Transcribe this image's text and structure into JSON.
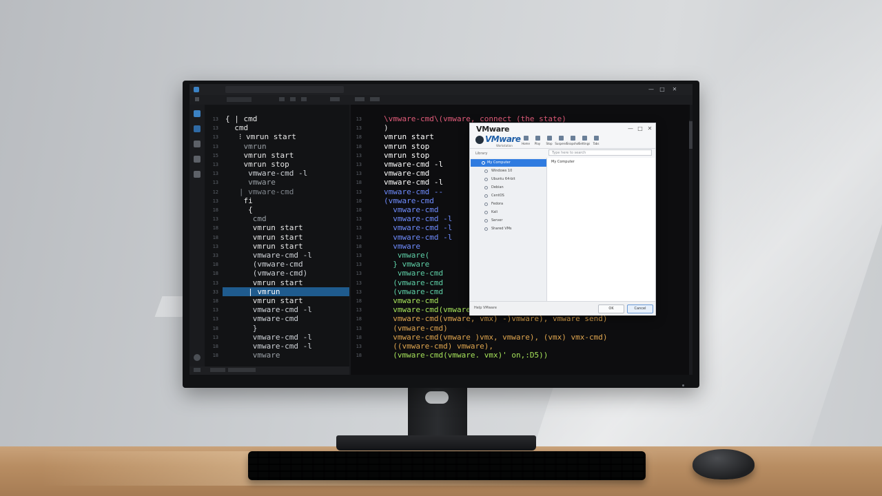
{
  "window": {
    "tabs": [
      "",
      ""
    ],
    "controls": [
      "—",
      "□",
      "✕"
    ]
  },
  "left_lines": [
    {
      "ln": "13",
      "text": "{ | cmd",
      "color": "#e8e8e8"
    },
    {
      "ln": "13",
      "text": "  cmd",
      "color": "#e8e8e8"
    },
    {
      "ln": "13",
      "text": "   ⁝ vmrun start",
      "color": "#e8e8e8"
    },
    {
      "ln": "13",
      "text": "    vmrun",
      "color": "#9aa0a6"
    },
    {
      "ln": "15",
      "text": "    vmrun start",
      "color": "#e8e8e8"
    },
    {
      "ln": "13",
      "text": "    vmrun stop",
      "color": "#e8e8e8"
    },
    {
      "ln": "13",
      "text": "     vmware-cmd -l",
      "color": "#cfd3d8"
    },
    {
      "ln": "13",
      "text": "     vmware",
      "color": "#9aa0a6"
    },
    {
      "ln": "12",
      "text": "   | vmware-cmd",
      "color": "#7f858c"
    },
    {
      "ln": "13",
      "text": "    fi",
      "color": "#e8e8e8"
    },
    {
      "ln": "18",
      "text": "     {",
      "color": "#e8e8e8"
    },
    {
      "ln": "13",
      "text": "      cmd",
      "color": "#9aa0a6"
    },
    {
      "ln": "18",
      "text": "      vmrun start",
      "color": "#e8e8e8"
    },
    {
      "ln": "18",
      "text": "      vmrun start",
      "color": "#e8e8e8"
    },
    {
      "ln": "13",
      "text": "      vmrun start",
      "color": "#e8e8e8"
    },
    {
      "ln": "33",
      "text": "      vmware-cmd -l",
      "color": "#cfd3d8"
    },
    {
      "ln": "18",
      "text": "      (vmware-cmd",
      "color": "#cfd3d8"
    },
    {
      "ln": "18",
      "text": "      (vmware-cmd)",
      "color": "#cfd3d8"
    },
    {
      "ln": "13",
      "text": "      vmrun start",
      "color": "#e8e8e8"
    },
    {
      "ln": "33",
      "text": "     | vmrun",
      "color": "#ffffff"
    },
    {
      "ln": "18",
      "text": "      vmrun start",
      "color": "#e8e8e8"
    },
    {
      "ln": "13",
      "text": "      vmware-cmd -l",
      "color": "#cfd3d8"
    },
    {
      "ln": "13",
      "text": "      vmware-cmd",
      "color": "#cfd3d8"
    },
    {
      "ln": "18",
      "text": "      }",
      "color": "#cfd3d8"
    },
    {
      "ln": "13",
      "text": "      vmware-cmd -l",
      "color": "#cfd3d8"
    },
    {
      "ln": "18",
      "text": "      vmware-cmd -l",
      "color": "#cfd3d8"
    },
    {
      "ln": "18",
      "text": "      vmware",
      "color": "#9aa0a6"
    }
  ],
  "right_lines": [
    {
      "ln": "13",
      "text": "\\vmware-cmd\\(vmware, connect (the state)",
      "color": "#e25c7a"
    },
    {
      "ln": "13",
      "text": ")",
      "color": "#e8e8e8"
    },
    {
      "ln": "18",
      "text": "vmrun start",
      "color": "#ffffff"
    },
    {
      "ln": "18",
      "text": "vmrun stop",
      "color": "#ffffff"
    },
    {
      "ln": "13",
      "text": "vmrun stop",
      "color": "#ffffff"
    },
    {
      "ln": "13",
      "text": "vmware-cmd -l",
      "color": "#ffffff"
    },
    {
      "ln": "13",
      "text": "vmware-cmd",
      "color": "#ffffff"
    },
    {
      "ln": "18",
      "text": "vmware-cmd -l",
      "color": "#ffffff"
    },
    {
      "ln": "13",
      "text": "vmware-cmd --",
      "color": "#6f8cff"
    },
    {
      "ln": "18",
      "text": "(vmware-cmd",
      "color": "#6f8cff"
    },
    {
      "ln": "18",
      "text": "  vmware-cmd",
      "color": "#6f8cff"
    },
    {
      "ln": "13",
      "text": "  vmware-cmd -l",
      "color": "#6f8cff"
    },
    {
      "ln": "13",
      "text": "  vmware-cmd -l",
      "color": "#6f8cff"
    },
    {
      "ln": "13",
      "text": "  vmware-cmd -l",
      "color": "#6f8cff"
    },
    {
      "ln": "18",
      "text": "  vmware",
      "color": "#6f8cff"
    },
    {
      "ln": "13",
      "text": "   vmware(",
      "color": "#5fd1a8"
    },
    {
      "ln": "13",
      "text": "  } vmware",
      "color": "#5fd1a8"
    },
    {
      "ln": "13",
      "text": "   vmware-cmd",
      "color": "#5fd1a8"
    },
    {
      "ln": "13",
      "text": "  (vmware-cmd",
      "color": "#5fd1a8"
    },
    {
      "ln": "13",
      "text": "  (vmware-cmd",
      "color": "#5fd1a8"
    },
    {
      "ln": "18",
      "text": "  vmware-cmd",
      "color": "#a6e35a"
    },
    {
      "ln": "13",
      "text": "  vmware-cmd(vmware) -l",
      "color": "#a6e35a"
    },
    {
      "ln": "18",
      "text": "  vmware-cmd(vmware, vmx) -)vmware), vmware send)",
      "color": "#e0a64f"
    },
    {
      "ln": "13",
      "text": "  (vmware-cmd)",
      "color": "#e0a64f"
    },
    {
      "ln": "18",
      "text": "  vmware-cmd(vmware )vmx, vmware), (vmx) vmx-cmd)",
      "color": "#e0a64f"
    },
    {
      "ln": "13",
      "text": "  ((vmware-cmd) vmware),",
      "color": "#e0a64f"
    },
    {
      "ln": "18",
      "text": "  (vmware-cmd(vmware. vmx)' on,:D5))",
      "color": "#a6e35a"
    }
  ],
  "dialog": {
    "title": "VMware",
    "brand": "VMware",
    "brand_sub": "Workstation",
    "toolbar": [
      "Home",
      "Play",
      "Stop",
      "Suspend",
      "Snapshot",
      "Settings",
      "Tabs"
    ],
    "library_label": "Library",
    "search_placeholder": "Type here to search",
    "tree": [
      "My Computer",
      "Windows 10",
      "Ubuntu 64-bit",
      "Debian",
      "CentOS",
      "Fedora",
      "Kali",
      "Server",
      "Shared VMs"
    ],
    "main_item": "My Computer",
    "footer_label": "Help VMware",
    "ok": "OK",
    "cancel": "Cancel"
  }
}
